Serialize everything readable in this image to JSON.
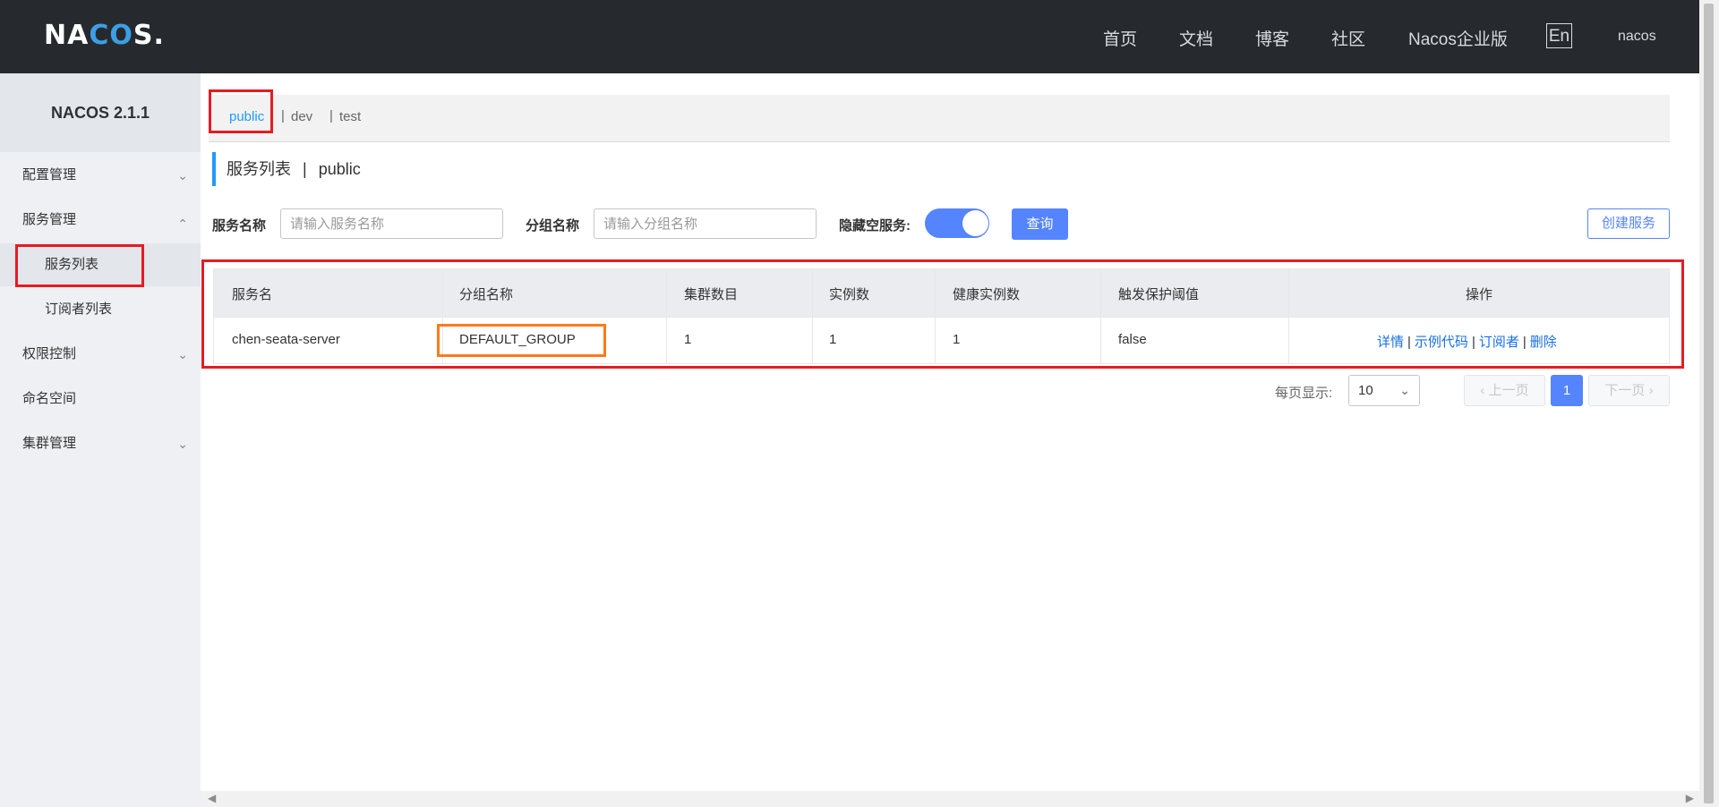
{
  "header": {
    "logo": "NACOS.",
    "nav": [
      "首页",
      "文档",
      "博客",
      "社区",
      "Nacos企业版"
    ],
    "lang_button": "En",
    "user": "nacos"
  },
  "sidebar": {
    "title": "NACOS 2.1.1",
    "items": [
      {
        "label": "配置管理",
        "chevron": "down"
      },
      {
        "label": "服务管理",
        "chevron": "up"
      },
      {
        "label": "服务列表",
        "sub": true,
        "active": true
      },
      {
        "label": "订阅者列表",
        "sub": true
      },
      {
        "label": "权限控制",
        "chevron": "down"
      },
      {
        "label": "命名空间"
      },
      {
        "label": "集群管理",
        "chevron": "down"
      }
    ]
  },
  "namespaces": {
    "items": [
      "public",
      "dev",
      "test"
    ],
    "active": "public",
    "separator": "|"
  },
  "page_title": {
    "text": "服务列表",
    "separator": "|",
    "namespace": "public"
  },
  "filters": {
    "service_name_label": "服务名称",
    "service_name_placeholder": "请输入服务名称",
    "group_name_label": "分组名称",
    "group_name_placeholder": "请输入分组名称",
    "hide_empty_label": "隐藏空服务:",
    "hide_empty_on": true,
    "query_button": "查询",
    "create_button": "创建服务"
  },
  "table": {
    "columns": [
      "服务名",
      "分组名称",
      "集群数目",
      "实例数",
      "健康实例数",
      "触发保护阈值",
      "操作"
    ],
    "rows": [
      {
        "service_name": "chen-seata-server",
        "group_name": "DEFAULT_GROUP",
        "cluster_count": "1",
        "instance_count": "1",
        "healthy_instance_count": "1",
        "protect_threshold": "false",
        "actions": [
          "详情",
          "示例代码",
          "订阅者",
          "删除"
        ]
      }
    ],
    "action_separator": "|"
  },
  "pagination": {
    "page_size_label": "每页显示:",
    "page_size": "10",
    "prev": "上一页",
    "current_page": "1",
    "next": "下一页"
  },
  "colors": {
    "header_bg": "#262a2e",
    "primary": "#5584ff",
    "accent_link": "#209bfa",
    "annotation_red": "#e61b23",
    "annotation_orange": "#ff7a1a"
  }
}
